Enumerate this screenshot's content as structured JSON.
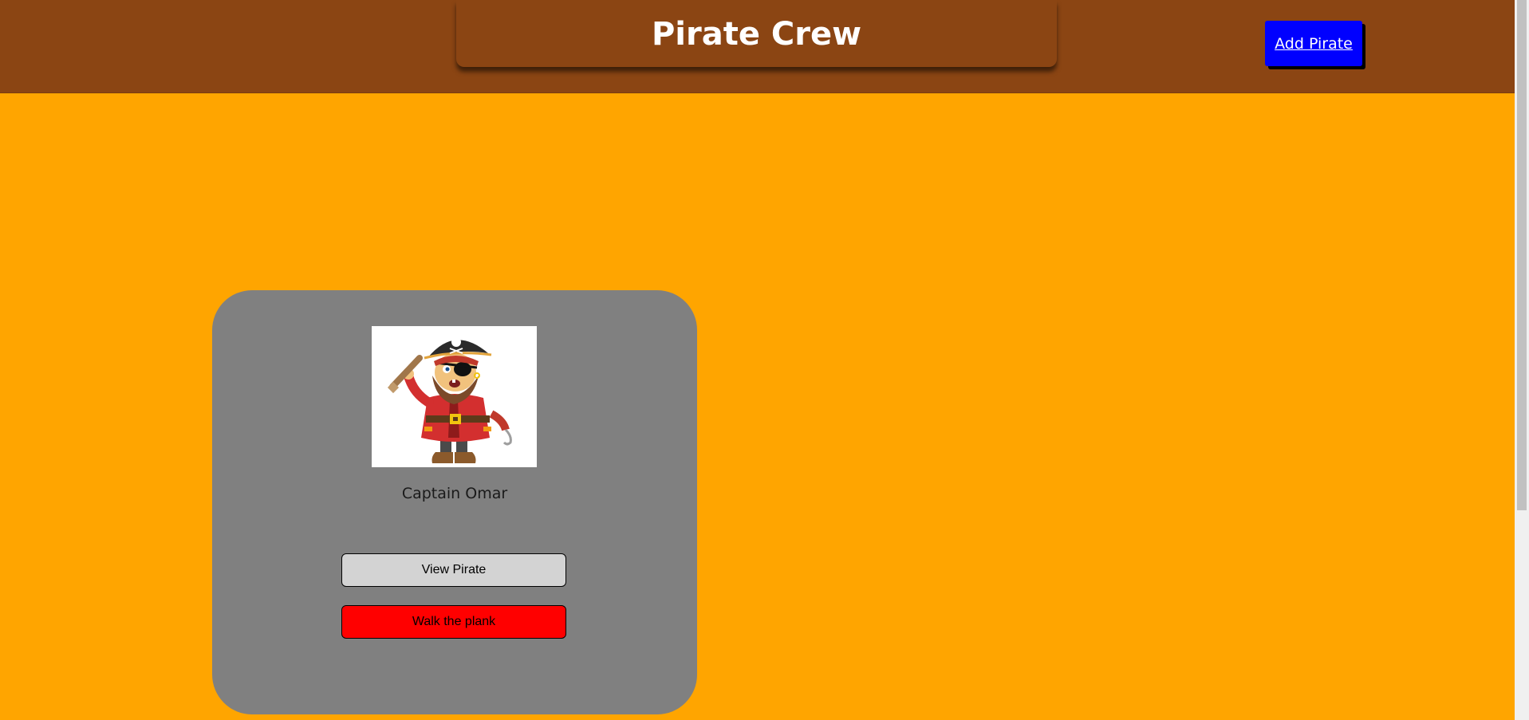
{
  "header": {
    "title": "Pirate Crew",
    "add_button_label": "Add Pirate"
  },
  "colors": {
    "page_background": "#ffa500",
    "header_background": "#8b4513",
    "add_button_background": "#0000ff",
    "card_background": "#808080",
    "view_button_background": "#d3d3d3",
    "plank_button_background": "#ff0000"
  },
  "crew": [
    {
      "name": "Captain Omar",
      "image": "pirate-captain-cartoon",
      "view_button_label": "View Pirate",
      "plank_button_label": "Walk the plank"
    }
  ]
}
